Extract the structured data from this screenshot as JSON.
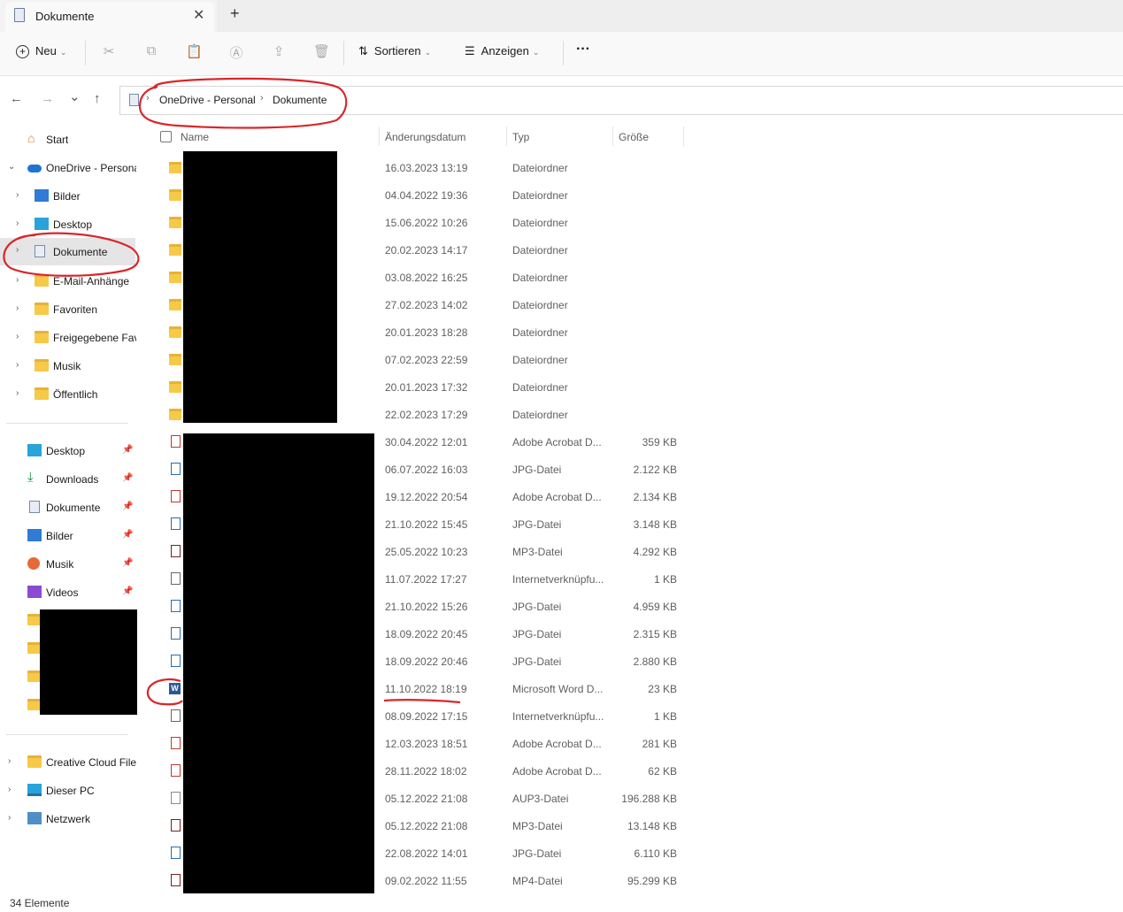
{
  "window": {
    "tab_title": "Dokumente",
    "close_glyph": "✕",
    "new_tab_glyph": "+"
  },
  "toolbar": {
    "new_label": "Neu",
    "sort_label": "Sortieren",
    "view_label": "Anzeigen",
    "more_glyph": "···",
    "icons": [
      "cut-icon",
      "copy-icon",
      "paste-icon",
      "rename-icon",
      "share-icon",
      "delete-icon"
    ]
  },
  "nav": {
    "back": "←",
    "forward": "→",
    "recent": "⌄",
    "up": "↑"
  },
  "breadcrumb": {
    "items": [
      "OneDrive - Personal",
      "Dokumente"
    ]
  },
  "sidebar": {
    "start": "Start",
    "onedrive": "OneDrive - Persona",
    "onedrive_children": [
      "Bilder",
      "Desktop",
      "Dokumente",
      "E-Mail-Anhänge",
      "Favoriten",
      "Freigegebene Fav",
      "Musik",
      "Öffentlich"
    ],
    "quick_access": [
      "Desktop",
      "Downloads",
      "Dokumente",
      "Bilder",
      "Musik",
      "Videos"
    ],
    "bottom": [
      "Creative Cloud Files",
      "Dieser PC",
      "Netzwerk"
    ]
  },
  "columns": {
    "name": "Name",
    "date": "Änderungsdatum",
    "type": "Typ",
    "size": "Größe"
  },
  "rows": [
    {
      "date": "16.03.2023 13:19",
      "type": "Dateiordner",
      "size": "",
      "icon": "folder"
    },
    {
      "date": "04.04.2022 19:36",
      "type": "Dateiordner",
      "size": "",
      "icon": "folder"
    },
    {
      "date": "15.06.2022 10:26",
      "type": "Dateiordner",
      "size": "",
      "icon": "folder"
    },
    {
      "date": "20.02.2023 14:17",
      "type": "Dateiordner",
      "size": "",
      "icon": "folder"
    },
    {
      "date": "03.08.2022 16:25",
      "type": "Dateiordner",
      "size": "",
      "icon": "folder"
    },
    {
      "date": "27.02.2023 14:02",
      "type": "Dateiordner",
      "size": "",
      "icon": "folder"
    },
    {
      "date": "20.01.2023 18:28",
      "type": "Dateiordner",
      "size": "",
      "icon": "folder"
    },
    {
      "date": "07.02.2023 22:59",
      "type": "Dateiordner",
      "size": "",
      "icon": "folder"
    },
    {
      "date": "20.01.2023 17:32",
      "type": "Dateiordner",
      "size": "",
      "icon": "folder"
    },
    {
      "date": "22.02.2023 17:29",
      "type": "Dateiordner",
      "size": "",
      "icon": "folder"
    },
    {
      "date": "30.04.2022 12:01",
      "type": "Adobe Acrobat D...",
      "size": "359 KB",
      "icon": "pdf"
    },
    {
      "date": "06.07.2022 16:03",
      "type": "JPG-Datei",
      "size": "2.122 KB",
      "icon": "jpg"
    },
    {
      "date": "19.12.2022 20:54",
      "type": "Adobe Acrobat D...",
      "size": "2.134 KB",
      "icon": "pdf"
    },
    {
      "date": "21.10.2022 15:45",
      "type": "JPG-Datei",
      "size": "3.148 KB",
      "icon": "jpg"
    },
    {
      "date": "25.05.2022 10:23",
      "type": "MP3-Datei",
      "size": "4.292 KB",
      "icon": "media"
    },
    {
      "date": "11.07.2022 17:27",
      "type": "Internetverknüpfu...",
      "size": "1 KB",
      "icon": "link"
    },
    {
      "date": "21.10.2022 15:26",
      "type": "JPG-Datei",
      "size": "4.959 KB",
      "icon": "jpg"
    },
    {
      "date": "18.09.2022 20:45",
      "type": "JPG-Datei",
      "size": "2.315 KB",
      "icon": "jpg"
    },
    {
      "date": "18.09.2022 20:46",
      "type": "JPG-Datei",
      "size": "2.880 KB",
      "icon": "jpg"
    },
    {
      "date": "11.10.2022 18:19",
      "type": "Microsoft Word D...",
      "size": "23 KB",
      "icon": "word"
    },
    {
      "date": "08.09.2022 17:15",
      "type": "Internetverknüpfu...",
      "size": "1 KB",
      "icon": "link"
    },
    {
      "date": "12.03.2023 18:51",
      "type": "Adobe Acrobat D...",
      "size": "281 KB",
      "icon": "pdf"
    },
    {
      "date": "28.11.2022 18:02",
      "type": "Adobe Acrobat D...",
      "size": "62 KB",
      "icon": "pdf"
    },
    {
      "date": "05.12.2022 21:08",
      "type": "AUP3-Datei",
      "size": "196.288 KB",
      "icon": "file"
    },
    {
      "date": "05.12.2022 21:08",
      "type": "MP3-Datei",
      "size": "13.148 KB",
      "icon": "media"
    },
    {
      "date": "22.08.2022 14:01",
      "type": "JPG-Datei",
      "size": "6.110 KB",
      "icon": "jpg"
    },
    {
      "date": "09.02.2022 11:55",
      "type": "MP4-Datei",
      "size": "95.299 KB",
      "icon": "media"
    }
  ],
  "status": {
    "count": "34 Elemente"
  },
  "colors": {
    "annotation": "#d9262b",
    "folder": "#f7c948",
    "selected_bg": "#e5e5e5"
  }
}
